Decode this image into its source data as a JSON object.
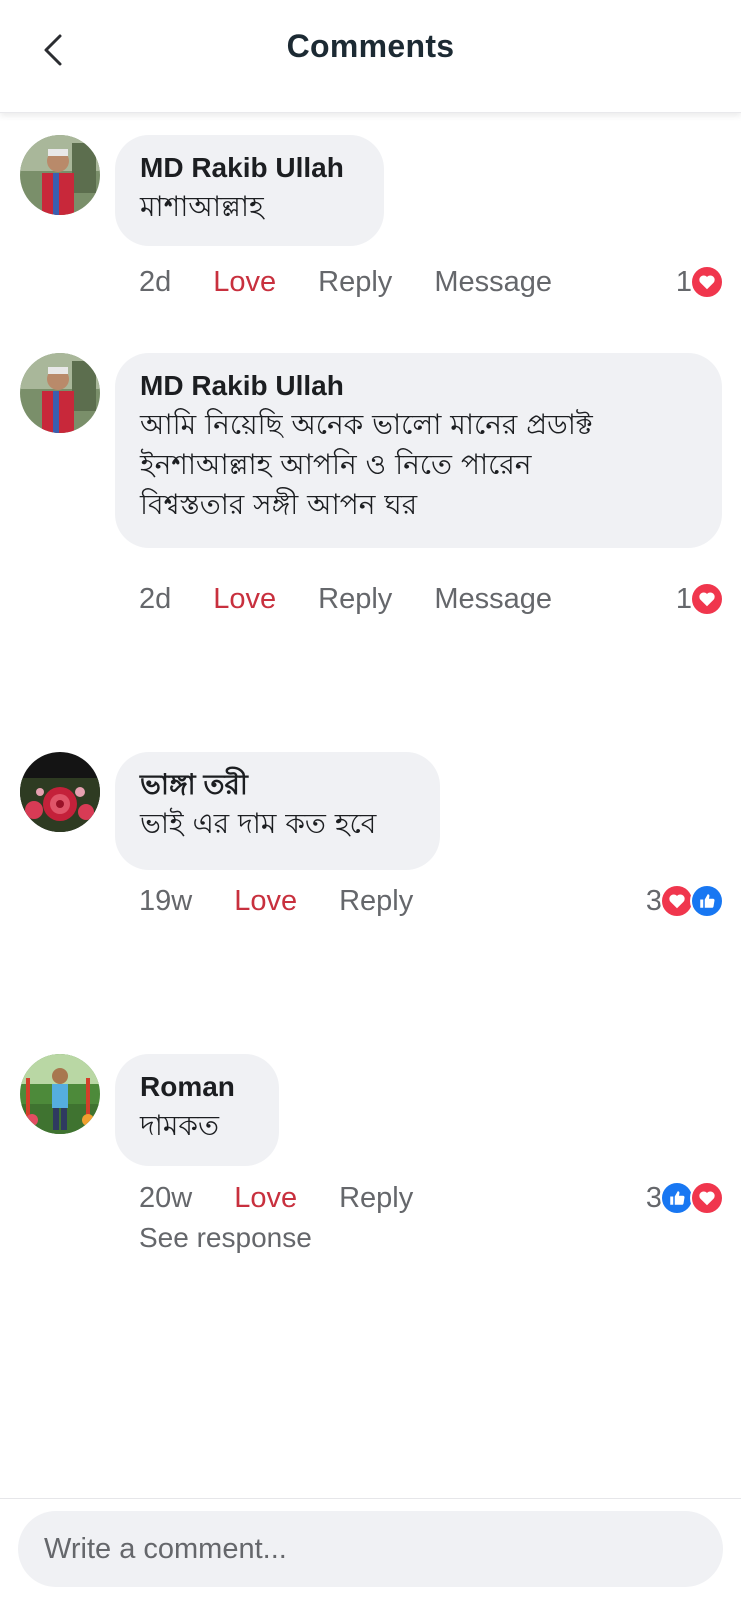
{
  "header": {
    "title": "Comments",
    "back_icon": "chevron-left-icon"
  },
  "comments": [
    {
      "author": "MD Rakib Ullah",
      "text_lines": [
        "মাশাআল্লাহ"
      ],
      "time": "2d",
      "love_label": "Love",
      "reply_label": "Reply",
      "message_label": "Message",
      "reaction_count": "1",
      "reactions": [
        "heart-icon"
      ]
    },
    {
      "author": "MD Rakib Ullah",
      "text_lines": [
        "আমি নিয়েছি অনেক ভালো মানের প্রডাক্ট",
        "ইনশাআল্লাহ আপনি ও নিতে পারেন",
        "বিশ্বস্ততার সঙ্গী আপন ঘর"
      ],
      "time": "2d",
      "love_label": "Love",
      "reply_label": "Reply",
      "message_label": "Message",
      "reaction_count": "1",
      "reactions": [
        "heart-icon"
      ]
    },
    {
      "author": "ভাঙ্গা তরী",
      "text_lines": [
        "ভাই এর দাম কত হবে"
      ],
      "time": "19w",
      "love_label": "Love",
      "reply_label": "Reply",
      "reaction_count": "3",
      "reactions": [
        "heart-icon",
        "like-icon"
      ]
    },
    {
      "author": "Roman",
      "text_lines": [
        "দামকত"
      ],
      "time": "20w",
      "love_label": "Love",
      "reply_label": "Reply",
      "reaction_count": "3",
      "reactions": [
        "like-icon",
        "heart-icon"
      ],
      "see_response_label": "See response"
    }
  ],
  "composer": {
    "placeholder": "Write a comment..."
  },
  "colors": {
    "love": "#c8303e",
    "meta": "#65676b",
    "bubble": "#f0f1f4",
    "heart": "#f0364d",
    "like": "#1877f2"
  }
}
